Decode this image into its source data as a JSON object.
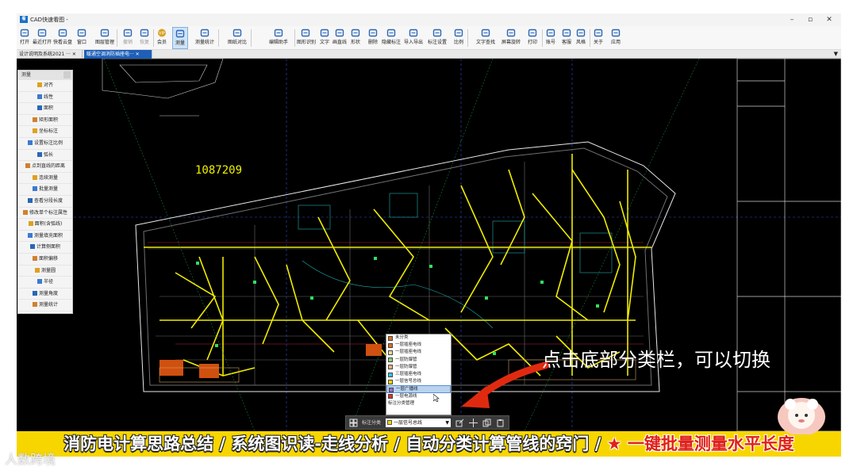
{
  "window": {
    "title": "CAD快速看图 -",
    "minimize": "–",
    "restore": "▫",
    "close": "✕"
  },
  "toolbar": {
    "items": [
      {
        "label": "打开",
        "icon": "folder-icon"
      },
      {
        "label": "最近打开",
        "icon": "clock-icon"
      },
      {
        "label": "快看云盘",
        "icon": "cloud-icon"
      },
      {
        "label": "窗口",
        "icon": "window-icon"
      },
      {
        "label": "图层管理",
        "icon": "layers-icon"
      },
      {
        "label": "撤销",
        "icon": "undo-icon"
      },
      {
        "label": "恢复",
        "icon": "redo-icon"
      },
      {
        "label": "会员",
        "icon": "vip-icon"
      },
      {
        "label": "测量",
        "icon": "measure-icon"
      },
      {
        "label": "测量统计",
        "icon": "measure-stats-icon"
      },
      {
        "label": "图纸对比",
        "icon": "compare-icon"
      },
      {
        "label": "编辑助手",
        "icon": "edit-assistant-icon"
      },
      {
        "label": "图形识别",
        "icon": "shape-recognition-icon"
      },
      {
        "label": "文字",
        "icon": "text-icon"
      },
      {
        "label": "画直线",
        "icon": "line-icon"
      },
      {
        "label": "形状",
        "icon": "shape-icon"
      },
      {
        "label": "删除",
        "icon": "eraser-icon"
      },
      {
        "label": "隐藏标注",
        "icon": "hide-icon"
      },
      {
        "label": "导入导出",
        "icon": "import-export-icon"
      },
      {
        "label": "标注设置",
        "icon": "annotation-settings-icon"
      },
      {
        "label": "比例",
        "icon": "ratio-icon"
      },
      {
        "label": "文字查找",
        "icon": "text-search-icon"
      },
      {
        "label": "屏幕旋转",
        "icon": "rotate-icon"
      },
      {
        "label": "打印",
        "icon": "print-icon"
      },
      {
        "label": "账号",
        "icon": "user-icon"
      },
      {
        "label": "客服",
        "icon": "headset-icon"
      },
      {
        "label": "风格",
        "icon": "style-icon"
      },
      {
        "label": "关于",
        "icon": "info-icon"
      },
      {
        "label": "应用",
        "icon": "apps-icon"
      }
    ]
  },
  "tabs": [
    {
      "label": "设计说明及系统2021 ···",
      "close": "✕"
    },
    {
      "label": "暖通空调消防插座电···",
      "close": "✕"
    }
  ],
  "tabs_more": "▼",
  "drawing": {
    "number": "1087209"
  },
  "measure_panel": {
    "title": "测量",
    "items": [
      "对齐",
      "线性",
      "面积",
      "矩形面积",
      "坐标标注",
      "设置标注比例",
      "弧长",
      "点到直线的距离",
      "连续测量",
      "批量测量",
      "查看分段长度",
      "修改单个标注属性",
      "面积(含弧线)",
      "测量填充面积",
      "计算侧面积",
      "面积偏移",
      "测量圆",
      "半径",
      "测量角度",
      "测量统计"
    ]
  },
  "category_popup": {
    "options": [
      {
        "label": "未分类",
        "color": "#e07020"
      },
      {
        "label": "一层插座电线",
        "color": "#e07020"
      },
      {
        "label": "一层插座电线",
        "color": "#e8e0a0"
      },
      {
        "label": "一层防爆管",
        "color": "#8fd080"
      },
      {
        "label": "一层防爆管",
        "color": "#f0b080"
      },
      {
        "label": "三层插座电线",
        "color": "#30c8e8"
      },
      {
        "label": "一层信号总线",
        "color": "#f5d800"
      },
      {
        "label": "一层广播线",
        "color": "#9070d0"
      },
      {
        "label": "一层电源线",
        "color": "#e03030"
      },
      {
        "label": "标注分类管理",
        "color": ""
      }
    ]
  },
  "bottom_bar": {
    "label": "标注分类",
    "selected": "一层信号总线",
    "selected_color": "#f5d800",
    "dropdown": "▼"
  },
  "annotation": "点击底部分类栏，可以切换",
  "caption": {
    "text": "消防电计算思路总结 / 系统图识读-走线分析 / 自动分类计算管线的窍门 / ",
    "highlight": "★ 一键批量测量水平长度"
  },
  "watermark": "人数跨境"
}
